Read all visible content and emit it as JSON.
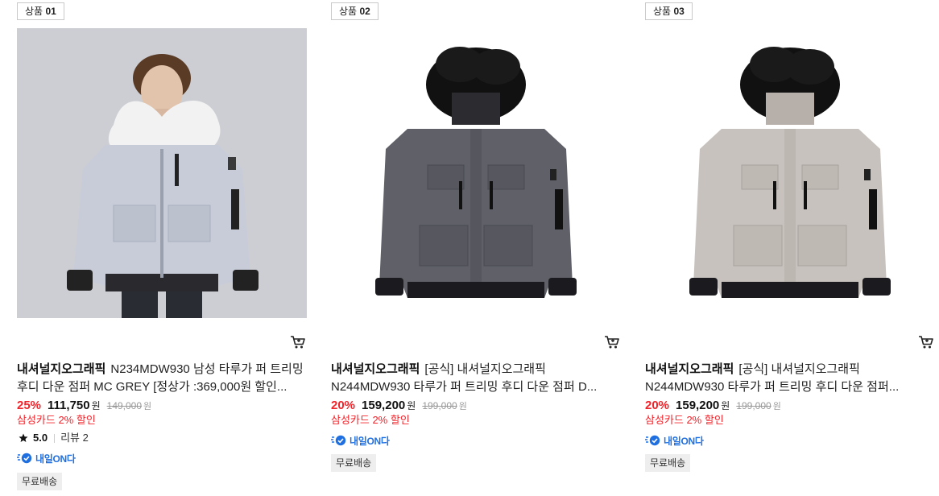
{
  "products": [
    {
      "rank_label": "상품",
      "rank_num": "01",
      "brand": "내셔널지오그래픽",
      "name": "N234MDW930 남성 타루가 퍼 트리밍 후디 다운 점퍼 MC GREY [정상가 :369,000원 할인...",
      "discount": "25%",
      "price": "111,750",
      "currency": "원",
      "original_price": "149,000",
      "card_promo": "삼성카드 2% 할인",
      "rating": "5.0",
      "review_label": "리뷰 2",
      "delivery_logo": "내일ON다",
      "free_shipping": "무료배송",
      "image_desc": "model-wearing-light-grey-down-jacket",
      "jacket_color": "#c8ccd9",
      "fur_color": "#f4f4f4"
    },
    {
      "rank_label": "상품",
      "rank_num": "02",
      "brand": "내셔널지오그래픽",
      "name": "[공식] 내셔널지오그래픽 N244MDW930 타루가 퍼 트리밍 후디 다운 점퍼 D...",
      "discount": "20%",
      "price": "159,200",
      "currency": "원",
      "original_price": "199,000",
      "card_promo": "삼성카드 2% 할인",
      "delivery_logo": "내일ON다",
      "free_shipping": "무료배송",
      "image_desc": "dark-grey-down-jacket-black-fur-hood",
      "jacket_color": "#5f6068",
      "fur_color": "#111111"
    },
    {
      "rank_label": "상품",
      "rank_num": "03",
      "brand": "내셔널지오그래픽",
      "name": "[공식] 내셔널지오그래픽 N244MDW930 타루가 퍼 트리밍 후디 다운 점퍼...",
      "discount": "20%",
      "price": "159,200",
      "currency": "원",
      "original_price": "199,000",
      "card_promo": "삼성카드 2% 할인",
      "delivery_logo": "내일ON다",
      "free_shipping": "무료배송",
      "image_desc": "beige-grey-down-jacket-black-fur-hood",
      "jacket_color": "#c7c2be",
      "fur_color": "#111111"
    }
  ],
  "colors": {
    "discount_red": "#f2242b",
    "delivery_blue": "#1f6fe0",
    "photo_bg": "#ccced3"
  }
}
